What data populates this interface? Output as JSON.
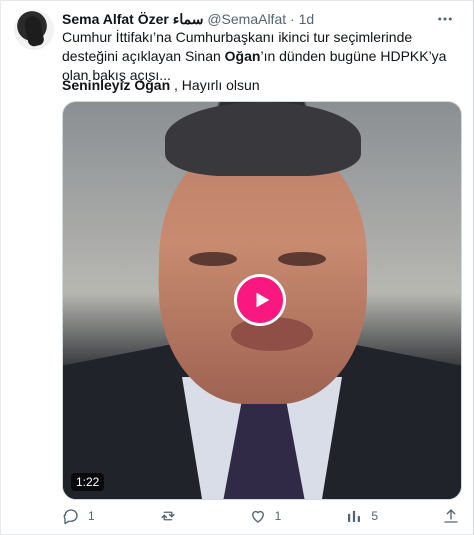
{
  "tweet": {
    "author_name": "Sema Alfat Özer سماء",
    "handle": "@SemaAlfat",
    "separator": "·",
    "time": "1d",
    "text_parts": [
      "Cumhur İttifakı’na Cumhurbaşkanı ikinci tur seçimlerinde desteğini açıklayan Sinan ",
      "Oğan",
      "’ın dünden bugüne HDPKK’ya olan bakış açısı..."
    ],
    "mention_bold": "Seninleyiz Oğan",
    "mention_rest": " , Hayırlı olsun",
    "video_duration": "1:22"
  },
  "actions": {
    "reply_count": "1",
    "retweet_count": "",
    "like_count": "1",
    "views_count": "5"
  },
  "colors": {
    "play_button": "#f91880",
    "secondary_text": "#536471"
  },
  "icons": [
    "more-options-icon",
    "play-icon",
    "reply-icon",
    "retweet-icon",
    "like-icon",
    "views-icon",
    "share-icon"
  ]
}
